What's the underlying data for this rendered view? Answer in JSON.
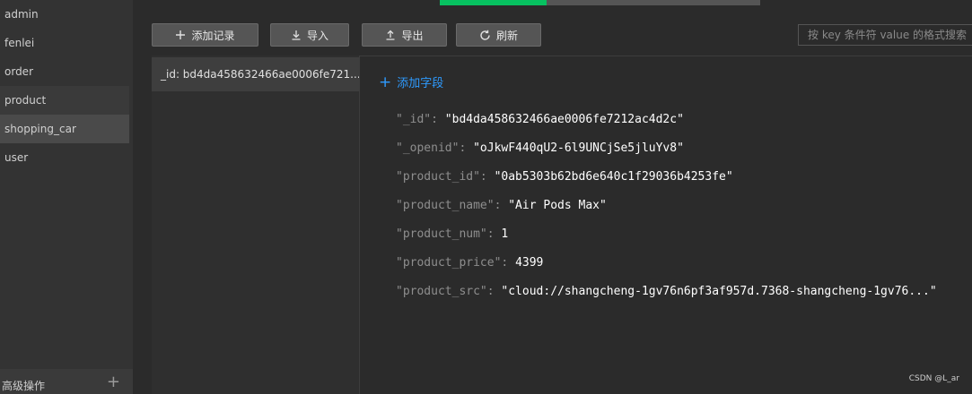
{
  "sidebar": {
    "collections": [
      "admin",
      "fenlei",
      "order",
      "product",
      "shopping_car",
      "user"
    ],
    "selected": "shopping_car",
    "advanced_label": "高级操作",
    "advanced_add": "+"
  },
  "toolbar": {
    "add_record": "添加记录",
    "import": "导入",
    "export": "导出",
    "refresh": "刷新",
    "search_placeholder": "按 key 条件符 value 的格式搜索"
  },
  "records": [
    "_id: bd4da458632466ae0006fe721..."
  ],
  "detail": {
    "add_field": "添加字段",
    "fields": [
      {
        "key": "\"_id\"",
        "value": "\"bd4da458632466ae0006fe7212ac4d2c\""
      },
      {
        "key": "\"_openid\"",
        "value": "\"oJkwF440qU2-6l9UNCjSe5jluYv8\""
      },
      {
        "key": "\"product_id\"",
        "value": "\"0ab5303b62bd6e640c1f29036b4253fe\""
      },
      {
        "key": "\"product_name\"",
        "value": "\"Air Pods Max\""
      },
      {
        "key": "\"product_num\"",
        "value": "1"
      },
      {
        "key": "\"product_price\"",
        "value": "4399"
      },
      {
        "key": "\"product_src\"",
        "value": "\"cloud://shangcheng-1gv76n6pf3af957d.7368-shangcheng-1gv76...\""
      }
    ]
  },
  "watermark": "CSDN @L_ar",
  "colors": {
    "background": "#2b2b2b",
    "sidebar": "#333333",
    "accent_green": "#07c160",
    "link_blue": "#2e9bff"
  }
}
